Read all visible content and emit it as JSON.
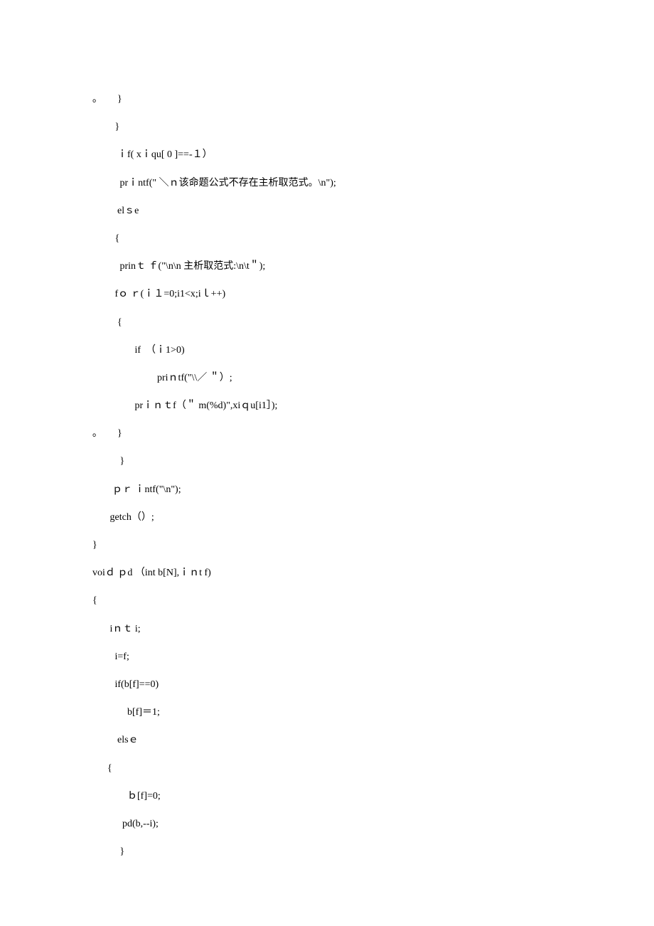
{
  "lines": [
    "｡　　}",
    "         }",
    "          ｉf( xｉqu[ 0 ]==-１）",
    "           prｉntf(\" ＼ｎ该命题公式不存在主析取范式。\\n\");",
    "          elｓe",
    "         {",
    "           prinｔ ｆ(\"\\n\\n 主析取范式:\\n\\t＂);",
    "         fｏ ｒ(ｉ１=0;i1<x;iｌ++)",
    "          {",
    "                 if  （ｉ1>0)",
    "                          priｎtf(\"\\\\／ ＂）;",
    "                 prｉｎｔf（＂ m(%d)\",xiｑu[i1］);",
    "｡　　}",
    "           }",
    "        ｐｒ ｉntf(\"\\n\");",
    "       getch（）;",
    "}",
    "voiｄ ｐd （int b[N],ｉｎt f)",
    "{",
    "       iｎｔ i;",
    "         i=f;",
    "         if(b[f]==0)",
    "              b[f]＝1;",
    "          elsｅ",
    "      {",
    "              ｂ[f]=0;",
    "            pd(b,--i);",
    "           }"
  ]
}
